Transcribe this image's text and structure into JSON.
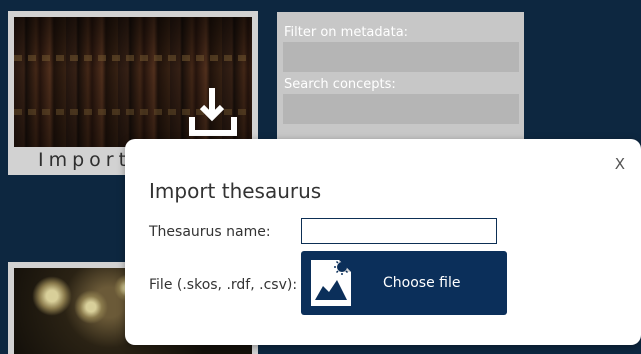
{
  "background_color": "#0d2740",
  "import_tile": {
    "label": "Import t",
    "icon": "import-tray-arrow-icon"
  },
  "filters": {
    "metadata_label": "Filter on metadata:",
    "metadata_value": "",
    "concepts_label": "Search concepts:",
    "concepts_value": ""
  },
  "modal": {
    "close_label": "X",
    "title": "Import thesaurus",
    "name_label": "Thesaurus name:",
    "name_value": "",
    "file_label": "File (.skos, .rdf, .csv):",
    "choose_file_label": "Choose file",
    "choose_file_icon": "image-file-icon",
    "accent_color": "#0b2f5a"
  }
}
